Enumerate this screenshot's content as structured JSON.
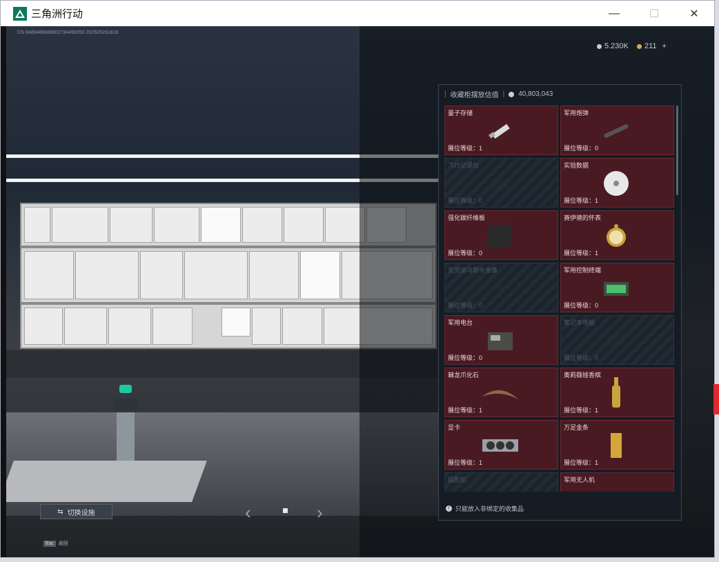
{
  "window": {
    "title": "三角洲行动",
    "controls": [
      "minimize",
      "maximize",
      "close"
    ]
  },
  "hud": {
    "uid_text": "CN 8489486668802794490050 202605261816",
    "currency_silver": "5.230K",
    "currency_gold": "211",
    "currency_add": "+"
  },
  "collection": {
    "header_label": "收藏柜摆放估值",
    "header_value": "40,803,043",
    "level_prefix": "展位等级：",
    "items": [
      {
        "name": "量子存储",
        "level": "1",
        "unlocked": true,
        "icon": "usb-drive-icon"
      },
      {
        "name": "军用炮弹",
        "level": "0",
        "unlocked": true,
        "icon": "shell-icon"
      },
      {
        "name": "飞行记录仪",
        "level": "0",
        "unlocked": false,
        "icon": "recorder-icon"
      },
      {
        "name": "实验数据",
        "level": "1",
        "unlocked": true,
        "icon": "disc-icon"
      },
      {
        "name": "强化碳纤维板",
        "level": "0",
        "unlocked": true,
        "icon": "carbon-plate-icon"
      },
      {
        "name": "赛伊德的怀表",
        "level": "1",
        "unlocked": true,
        "icon": "pocket-watch-icon"
      },
      {
        "name": "克劳迪乌斯半身像",
        "level": "0",
        "unlocked": false,
        "icon": "bust-icon"
      },
      {
        "name": "军用控制终端",
        "level": "0",
        "unlocked": true,
        "icon": "terminal-icon"
      },
      {
        "name": "军用电台",
        "level": "0",
        "unlocked": true,
        "icon": "radio-icon"
      },
      {
        "name": "笔记本电脑",
        "level": "0",
        "unlocked": false,
        "icon": "laptop-icon"
      },
      {
        "name": "棘龙爪化石",
        "level": "1",
        "unlocked": true,
        "icon": "claw-fossil-icon"
      },
      {
        "name": "奥莉薇娅香槟",
        "level": "1",
        "unlocked": true,
        "icon": "champagne-icon"
      },
      {
        "name": "显卡",
        "level": "1",
        "unlocked": true,
        "icon": "gpu-icon"
      },
      {
        "name": "万足金条",
        "level": "1",
        "unlocked": true,
        "icon": "gold-bar-icon"
      },
      {
        "name": "摄影机",
        "level": "",
        "unlocked": false,
        "icon": "camera-icon"
      },
      {
        "name": "军用无人机",
        "level": "",
        "unlocked": true,
        "icon": "drone-icon"
      }
    ],
    "footer_note": "只能放入非绑定的收集品"
  },
  "controls": {
    "switch_label": "切换设施",
    "esc_key": "Esc",
    "esc_label": "返回"
  },
  "colors": {
    "card_bg": "#4a1a22",
    "locked_bg": "#1b232d",
    "accent_green": "#0c7a5a",
    "red_tab": "#e5262c"
  }
}
